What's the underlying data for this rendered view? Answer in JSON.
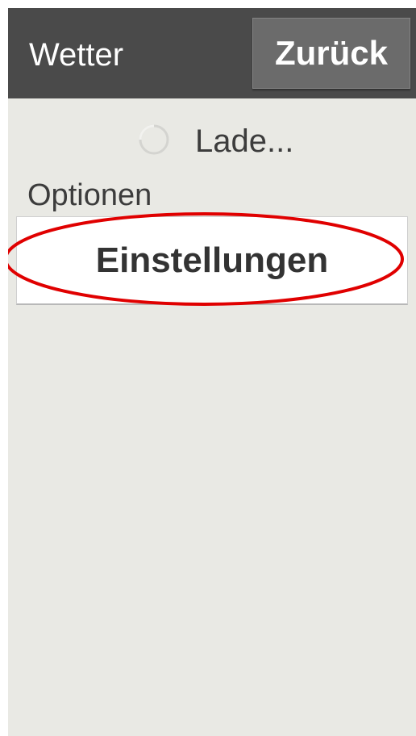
{
  "header": {
    "title": "Wetter",
    "back_label": "Zurück"
  },
  "loading": {
    "text": "Lade..."
  },
  "options": {
    "section_label": "Optionen",
    "settings_label": "Einstellungen"
  },
  "colors": {
    "header_bg": "#4a4a4a",
    "screen_bg": "#e9e9e4",
    "highlight": "#e00000"
  }
}
